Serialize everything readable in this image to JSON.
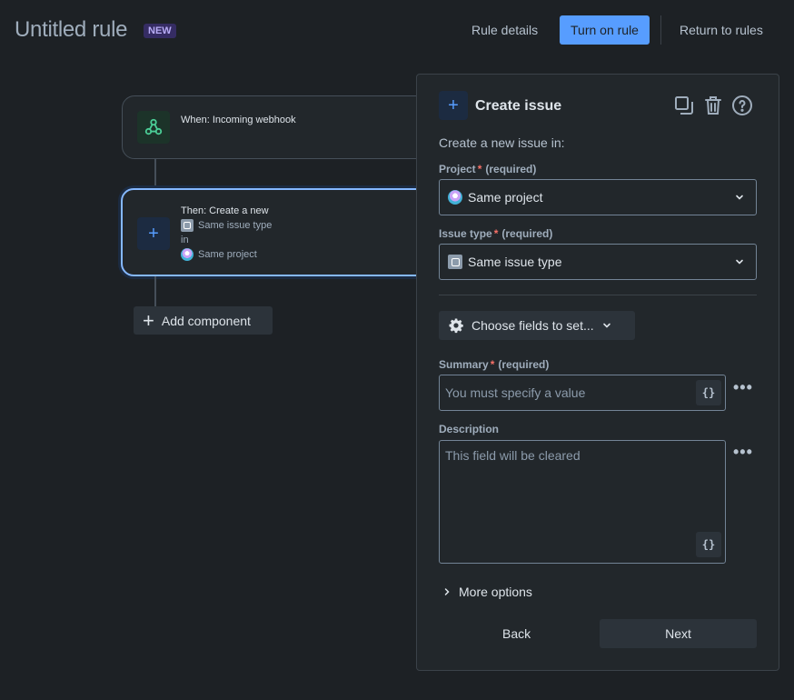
{
  "header": {
    "title": "Untitled rule",
    "badge": "NEW",
    "rule_details": "Rule details",
    "turn_on_rule": "Turn on rule",
    "return_to_rules": "Return to rules"
  },
  "flow": {
    "trigger_label": "When: Incoming webhook",
    "action": {
      "line1": "Then: Create a new",
      "issue_type": "Same issue type",
      "in": "in",
      "project": "Same project"
    },
    "add_component": "Add component"
  },
  "panel": {
    "title": "Create issue",
    "intro": "Create a new issue in:",
    "project_label": "Project",
    "required_marker": "*",
    "required_text": "(required)",
    "project_value": "Same project",
    "issue_type_label": "Issue type",
    "issue_type_value": "Same issue type",
    "choose_fields": "Choose fields to set...",
    "summary_label": "Summary",
    "summary_placeholder": "You must specify a value",
    "description_label": "Description",
    "description_placeholder": "This field will be cleared",
    "variable_button": "{}",
    "more_menu": "•••",
    "more_options": "More options",
    "back": "Back",
    "next": "Next"
  },
  "colors": {
    "background": "#1d2125",
    "primary_button": "#579dff",
    "selected_border": "#85b8ff",
    "webhook_icon": "#4bce97",
    "required": "#f87168"
  },
  "icons": [
    "webhook-icon",
    "plus-icon",
    "copy-icon",
    "trash-icon",
    "help-icon",
    "chevron-down-icon",
    "gear-icon",
    "chevron-right-icon"
  ]
}
